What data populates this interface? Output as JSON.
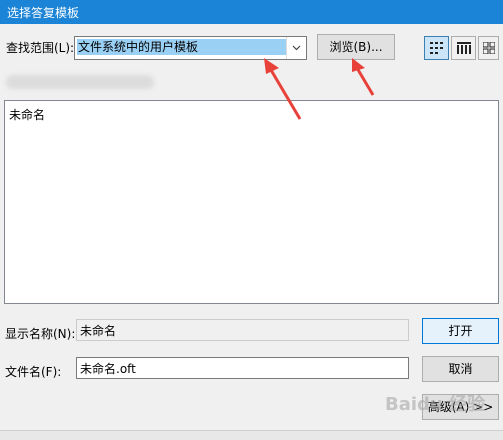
{
  "window": {
    "title": "选择答复模板"
  },
  "lookin": {
    "label": "查找范围(L):",
    "value": "文件系统中的用户模板"
  },
  "toolbar": {
    "browse_label": "浏览(B)..."
  },
  "list": {
    "items": [
      "未命名"
    ]
  },
  "display_name": {
    "label": "显示名称(N):",
    "value": "未命名"
  },
  "file_name": {
    "label": "文件名(F):",
    "value": "未命名.oft"
  },
  "buttons": {
    "open": "打开",
    "cancel": "取消",
    "advanced": "高级(A) >>"
  },
  "watermark": {
    "text": "Baidu 经验"
  },
  "colors": {
    "titlebar": "#1b84d6",
    "selection": "#9bd0f5",
    "annotation_arrow": "#e8413a"
  },
  "icons": {
    "dropdown": "chevron-down-icon",
    "list_view": "list-view-icon",
    "details_view": "details-view-icon",
    "grid_view": "grid-view-icon"
  }
}
